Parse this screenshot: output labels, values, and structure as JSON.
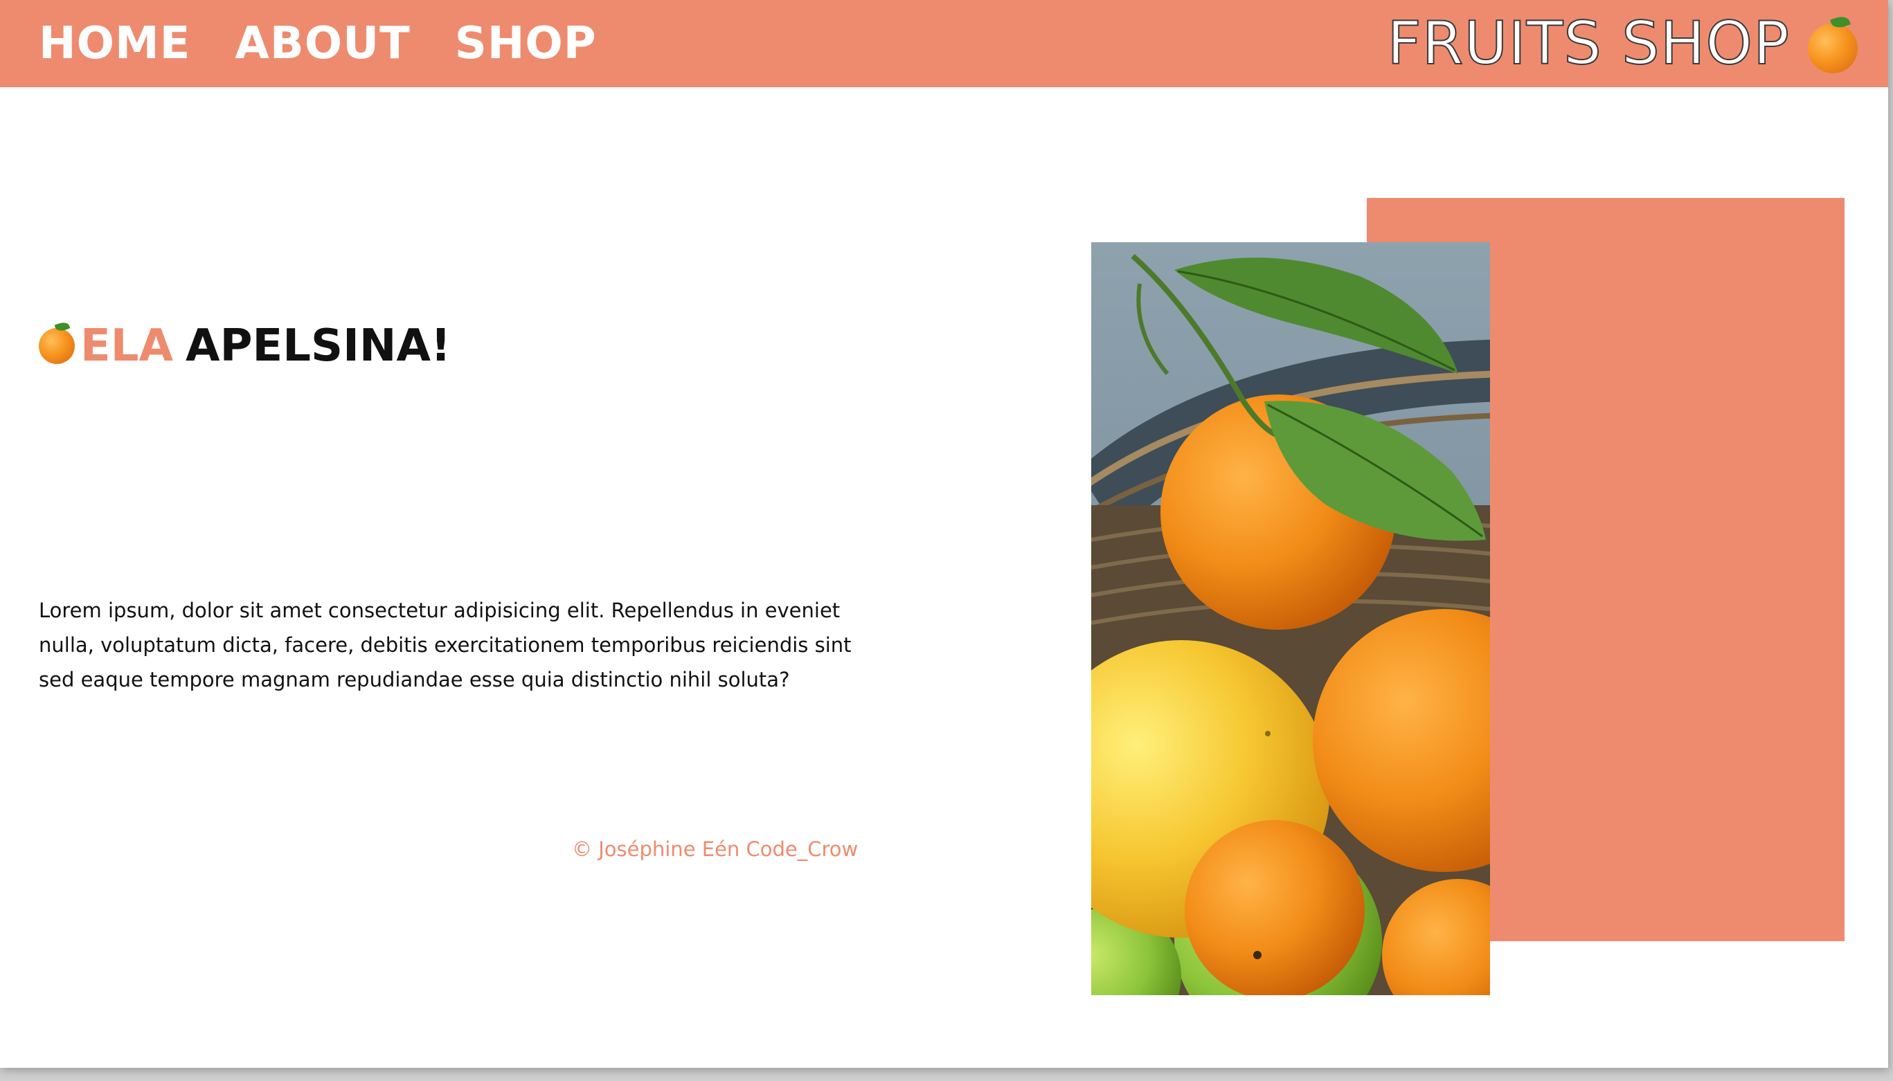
{
  "nav": {
    "items": [
      "HOME",
      "ABOUT",
      "SHOP"
    ]
  },
  "brand": {
    "title": "FRUITS SHOP",
    "icon": "orange-icon"
  },
  "hero": {
    "title_accent": "ELA",
    "title_rest": "APELSINA!",
    "title_icon": "orange-icon",
    "body": "Lorem ipsum, dolor sit amet consectetur adipisicing elit. Repellendus in eveniet nulla, voluptatum dicta, facere, debitis exercitationem temporibus reiciendis sint sed eaque tempore magnam repudiandae esse quia distinctio nihil soluta?",
    "credit": "© Joséphine Eén Code_Crow"
  },
  "colors": {
    "accent": "#ee8b6f",
    "text": "#111111",
    "background": "#ffffff"
  },
  "image": {
    "subject": "basket of oranges and grapefruit with leaves"
  }
}
